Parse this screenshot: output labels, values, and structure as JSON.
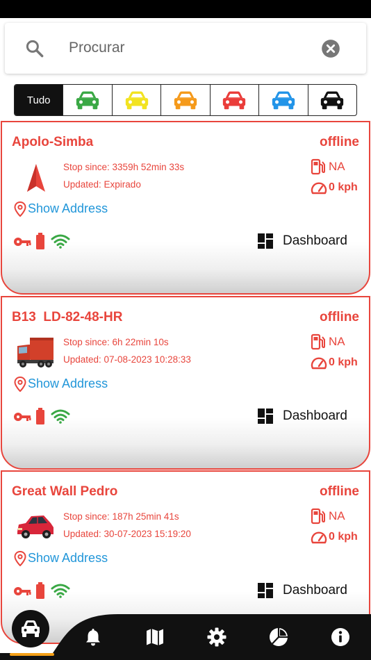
{
  "search": {
    "placeholder": "Procurar"
  },
  "filters": {
    "all_label": "Tudo",
    "car_colors": [
      "#3aa845",
      "#f2e321",
      "#f59a1b",
      "#ea3d3a",
      "#2294e8",
      "#111111"
    ]
  },
  "vehicles": [
    {
      "name": "Apolo-Simba",
      "status": "offline",
      "stop_since": "Stop since: 3359h 52min 33s",
      "updated": "Updated: Expirado",
      "fuel": "NA",
      "speed": "0 kph",
      "address_link": "Show Address",
      "dashboard_label": "Dashboard",
      "thumb": "navigation-arrow-icon"
    },
    {
      "name": "B13  LD-82-48-HR",
      "status": "offline",
      "stop_since": "Stop since: 6h 22min 10s",
      "updated": "Updated: 07-08-2023 10:28:33",
      "fuel": "NA",
      "speed": "0 kph",
      "address_link": "Show Address",
      "dashboard_label": "Dashboard",
      "thumb": "truck-photo"
    },
    {
      "name": "Great Wall Pedro",
      "status": "offline",
      "stop_since": "Stop since: 187h 25min 41s",
      "updated": "Updated: 30-07-2023 15:19:20",
      "fuel": "NA",
      "speed": "0 kph",
      "address_link": "Show Address",
      "dashboard_label": "Dashboard",
      "thumb": "red-car-photo"
    }
  ],
  "colors": {
    "accent_red": "#e8453c",
    "link_blue": "#2196d9",
    "wifi_green": "#3aa845",
    "nav_dark": "#111111",
    "nav_indicator": "#f5a017"
  },
  "bottom_nav": {
    "items": [
      "car-icon",
      "bell-icon",
      "map-icon",
      "gear-icon",
      "pie-chart-icon",
      "info-icon"
    ]
  }
}
